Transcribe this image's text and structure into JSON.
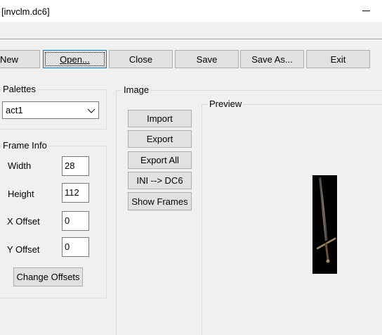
{
  "window": {
    "title": "[invclm.dc6]"
  },
  "toolbar": {
    "new_label": "New",
    "open_label": "Open...",
    "close_label": "Close",
    "save_label": "Save",
    "save_as_label": "Save As...",
    "exit_label": "Exit"
  },
  "palettes": {
    "group_label": "Palettes",
    "selected": "act1"
  },
  "frame_info": {
    "group_label": "Frame Info",
    "width_label": "Width",
    "width_value": "28",
    "height_label": "Height",
    "height_value": "112",
    "x_offset_label": "X Offset",
    "x_offset_value": "0",
    "y_offset_label": "Y Offset",
    "y_offset_value": "0",
    "change_offsets_label": "Change Offsets"
  },
  "image": {
    "group_label": "Image",
    "import_label": "Import",
    "export_label": "Export",
    "export_all_label": "Export All",
    "ini_dc6_label": "INI --> DC6",
    "show_frames_label": "Show Frames"
  },
  "preview": {
    "group_label": "Preview",
    "image_icon": "sword-icon"
  }
}
